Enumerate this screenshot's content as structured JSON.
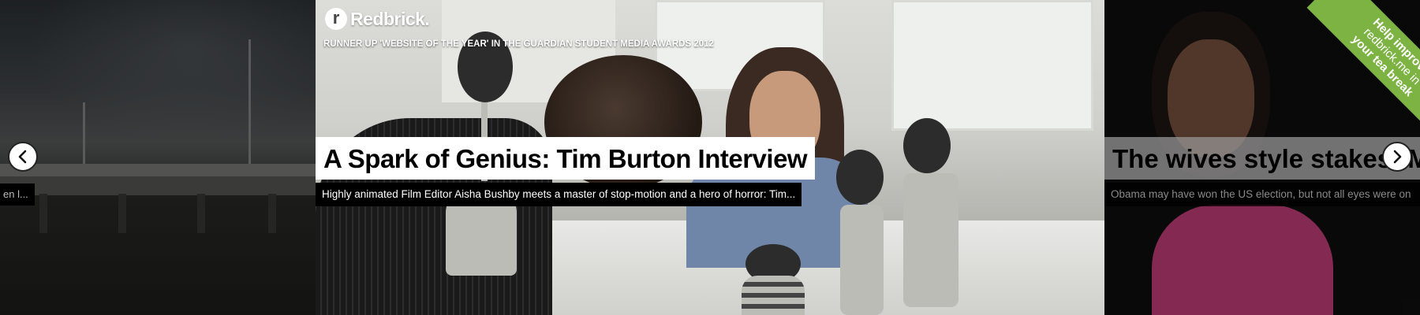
{
  "brand": {
    "logo_letter": "r",
    "name": "Redbrick."
  },
  "tagline": "RUNNER UP 'WEBSITE OF THE YEAR' IN THE GUARDIAN STUDENT MEDIA AWARDS 2012",
  "slides": {
    "left": {
      "standfirst_fragment": "en l..."
    },
    "center": {
      "headline": "A Spark of Genius: Tim Burton Interview",
      "standfirst": "Highly animated Film Editor Aisha Bushby meets a master of stop-motion and a hero of horror: Tim..."
    },
    "right": {
      "headline": "The wives style stakes: M",
      "standfirst": "Obama may have won the US election, but not all eyes were on"
    }
  },
  "controls": {
    "prev_icon": "chevron-left-icon",
    "next_icon": "chevron-right-icon"
  },
  "ribbon": {
    "line1": "Help improve",
    "line2": "redbrick.me in",
    "line3": "your tea break",
    "color": "#7cb342"
  }
}
